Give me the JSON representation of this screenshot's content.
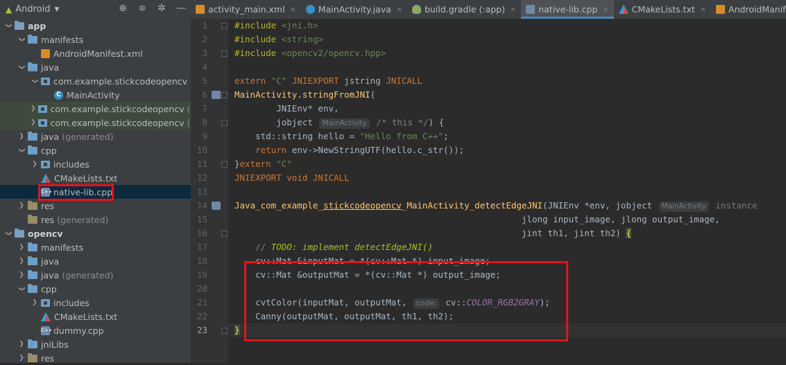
{
  "project_panel": {
    "title": "Android",
    "tree": [
      {
        "label": "app",
        "level": 0,
        "type": "module",
        "arrow": "expanded",
        "bold": true
      },
      {
        "label": "manifests",
        "level": 1,
        "type": "folder",
        "arrow": "expanded"
      },
      {
        "label": "AndroidManifest.xml",
        "level": 2,
        "type": "xml",
        "arrow": "none"
      },
      {
        "label": "java",
        "level": 1,
        "type": "folder",
        "arrow": "expanded"
      },
      {
        "label": "com.example.stickcodeopencv",
        "level": 2,
        "type": "package",
        "arrow": "expanded"
      },
      {
        "label": "MainActivity",
        "level": 3,
        "type": "class",
        "arrow": "none"
      },
      {
        "label": "com.example.stickcodeopencv",
        "suffix": "(andr",
        "level": 2,
        "type": "package",
        "arrow": "collapsed",
        "highlight": true
      },
      {
        "label": "com.example.stickcodeopencv",
        "suffix": "(test)",
        "level": 2,
        "type": "package",
        "arrow": "collapsed",
        "highlight": true
      },
      {
        "label": "java",
        "suffix": "(generated)",
        "level": 1,
        "type": "folder",
        "arrow": "collapsed"
      },
      {
        "label": "cpp",
        "level": 1,
        "type": "folder",
        "arrow": "expanded"
      },
      {
        "label": "includes",
        "level": 2,
        "type": "package",
        "arrow": "collapsed"
      },
      {
        "label": "CMakeLists.txt",
        "level": 2,
        "type": "cmake",
        "arrow": "none"
      },
      {
        "label": "native-lib.cpp",
        "level": 2,
        "type": "cpp",
        "arrow": "none",
        "selected": true
      },
      {
        "label": "res",
        "level": 1,
        "type": "res",
        "arrow": "collapsed"
      },
      {
        "label": "res",
        "suffix": "(generated)",
        "level": 1,
        "type": "res",
        "arrow": "none"
      },
      {
        "label": "opencv",
        "level": 0,
        "type": "module",
        "arrow": "expanded",
        "bold": true
      },
      {
        "label": "manifests",
        "level": 1,
        "type": "folder",
        "arrow": "collapsed"
      },
      {
        "label": "java",
        "level": 1,
        "type": "folder",
        "arrow": "collapsed"
      },
      {
        "label": "java",
        "suffix": "(generated)",
        "level": 1,
        "type": "folder",
        "arrow": "collapsed"
      },
      {
        "label": "cpp",
        "level": 1,
        "type": "folder",
        "arrow": "expanded"
      },
      {
        "label": "includes",
        "level": 2,
        "type": "package",
        "arrow": "collapsed"
      },
      {
        "label": "CMakeLists.txt",
        "level": 2,
        "type": "cmake",
        "arrow": "none"
      },
      {
        "label": "dummy.cpp",
        "level": 2,
        "type": "cpp",
        "arrow": "none"
      },
      {
        "label": "jniLibs",
        "level": 1,
        "type": "folder",
        "arrow": "collapsed"
      },
      {
        "label": "res",
        "level": 1,
        "type": "res",
        "arrow": "collapsed"
      }
    ]
  },
  "tabs": [
    {
      "label": "activity_main.xml",
      "icon": "xml"
    },
    {
      "label": "MainActivity.java",
      "icon": "java"
    },
    {
      "label": "build.gradle (:app)",
      "icon": "gradle"
    },
    {
      "label": "native-lib.cpp",
      "icon": "cpp",
      "active": true
    },
    {
      "label": "CMakeLists.txt",
      "icon": "cmake"
    },
    {
      "label": "AndroidManifest.xml",
      "icon": "xml"
    }
  ],
  "tab_close_glyph": "×",
  "editor": {
    "current_line": 23,
    "lines": [
      {
        "n": "1",
        "html": "<span class=\"pp\">#include</span> <span class=\"inc\">&lt;jni.h&gt;</span>"
      },
      {
        "n": "2",
        "html": "<span class=\"pp\">#include</span> <span class=\"inc\">&lt;string&gt;</span>"
      },
      {
        "n": "3",
        "html": "<span class=\"pp\">#include</span> <span class=\"inc\">&lt;opencv2/opencv.hpp&gt;</span>"
      },
      {
        "n": "4",
        "html": ""
      },
      {
        "n": "5",
        "html": "<span class=\"kw\">extern</span> <span class=\"str\">\"C\"</span> <span class=\"kw\">JNIEXPORT</span> jstring <span class=\"kw\">JNICALL</span>"
      },
      {
        "n": "6",
        "html": "<span class=\"fn\">MainActivity.stringFromJNI</span>("
      },
      {
        "n": "7",
        "html": "        JNIEnv* env,"
      },
      {
        "n": "8",
        "html": "        jobject <span class=\"hint\">MainActivity</span> <span class=\"cm\">/* this */</span>) {"
      },
      {
        "n": "9",
        "html": "    std::string hello = <span class=\"str\">\"Hello from C++\"</span>;"
      },
      {
        "n": "10",
        "html": "    <span class=\"kw\">return</span> env-&gt;NewStringUTF(hello.c_str());"
      },
      {
        "n": "11",
        "html": "}<span class=\"kw\">extern</span> <span class=\"str\">\"C\"</span>"
      },
      {
        "n": "12",
        "html": "<span class=\"kw\">JNIEXPORT</span> <span class=\"kw\">void</span> <span class=\"kw\">JNICALL</span>"
      },
      {
        "n": "13",
        "html": ""
      },
      {
        "n": "14",
        "html": "<span class=\"fn\">Java_com_example_<u>stickcodeopencv</u>_MainActivity_detectEdgeJNI</span>(JNIEnv *env, jobject <span class=\"hint\">MainActivity</span> <span class=\"mc\" style=\"font-style:normal;color:#7a7a7a\">instance</span>"
      },
      {
        "n": "15",
        "html": "                                                       jlong input_image, jlong output_image,"
      },
      {
        "n": "16",
        "html": "                                                       jint th1, jint th2) <span class=\"brace-m\">{</span>"
      },
      {
        "n": "17",
        "html": "    <span class=\"cm\">// </span><span class=\"todo\">TODO: implement detectEdgeJNI()</span>"
      },
      {
        "n": "18",
        "html": "    cv::Mat &amp;inputMat = *(cv::Mat *) input_image;"
      },
      {
        "n": "19",
        "html": "    cv::Mat &amp;outputMat = *(cv::Mat *) output_image;"
      },
      {
        "n": "20",
        "html": ""
      },
      {
        "n": "21",
        "html": "    cvtColor(inputMat, outputMat, <span class=\"hint\">code:</span> cv::<span class=\"mc\">COLOR_RGB2GRAY</span>);"
      },
      {
        "n": "22",
        "html": "    Canny(outputMat, outputMat, th1, th2);"
      },
      {
        "n": "23",
        "html": "<span class=\"brace-m\">}</span>"
      }
    ]
  }
}
